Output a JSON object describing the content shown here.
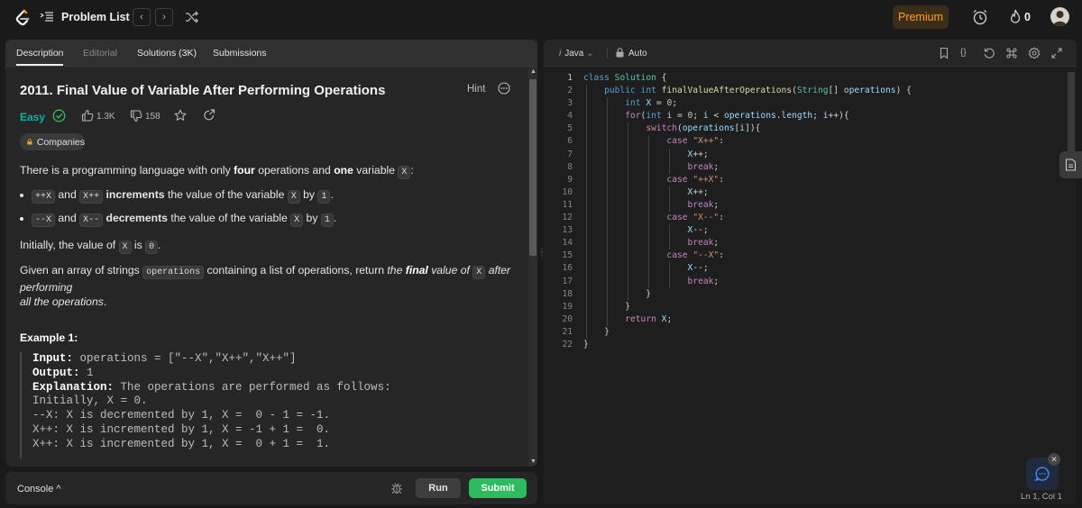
{
  "topbar": {
    "problem_list_label": "Problem List",
    "prev_label": "‹",
    "next_label": "›",
    "premium_label": "Premium",
    "streak_count": "0"
  },
  "tabs": [
    {
      "label": "Description",
      "active": true
    },
    {
      "label": "Editorial",
      "active": false
    },
    {
      "label": "Solutions (3K)",
      "active": false
    },
    {
      "label": "Submissions",
      "active": false
    }
  ],
  "problem": {
    "title": "2011. Final Value of Variable After Performing Operations",
    "hint_label": "Hint",
    "difficulty": "Easy",
    "likes": "1.3K",
    "dislikes": "158",
    "companies_label": "Companies",
    "intro_1": "There is a programming language with only ",
    "intro_bold_1": "four",
    "intro_2": " operations and ",
    "intro_bold_2": "one",
    "intro_3": " variable ",
    "var_x": "X",
    "intro_4": ":",
    "b1_code1": "++X",
    "b1_and": " and ",
    "b1_code2": "X++",
    "b1_bold": "increments",
    "b1_rest": " the value of the variable ",
    "b1_by": " by ",
    "b1_one": "1",
    "b1_end": ".",
    "b2_code1": "--X",
    "b2_code2": "X--",
    "b2_bold": "decrements",
    "init_1": "Initially, the value of ",
    "init_2": " is ",
    "init_zero": "0",
    "init_end": ".",
    "given_1": "Given an array of strings ",
    "given_code": "operations",
    "given_2": " containing a list of operations, return ",
    "given_it1": "the ",
    "given_bold": "final",
    "given_it2": " value of ",
    "given_it3": " after performing",
    "given_it4": "all the operations",
    "given_end": ".",
    "example_heading": "Example 1:",
    "example_input_label": "Input:",
    "example_input": " operations = [\"--X\",\"X++\",\"X++\"]",
    "example_output_label": "Output:",
    "example_output": " 1",
    "example_expl_label": "Explanation:",
    "example_expl": " The operations are performed as follows:",
    "example_lines": [
      "Initially, X = 0.",
      "--X: X is decremented by 1, X =  0 - 1 = -1.",
      "X++: X is incremented by 1, X = -1 + 1 =  0.",
      "X++: X is incremented by 1, X =  0 + 1 =  1."
    ]
  },
  "console": {
    "label": "Console ^",
    "run_label": "Run",
    "submit_label": "Submit"
  },
  "editor": {
    "language": "Java",
    "language_prefix": "i",
    "mode": "Auto",
    "braces_label": "{}",
    "status": "Ln 1, Col 1",
    "line_numbers": [
      "1",
      "2",
      "3",
      "4",
      "5",
      "6",
      "7",
      "8",
      "9",
      "10",
      "11",
      "12",
      "13",
      "14",
      "15",
      "16",
      "17",
      "18",
      "19",
      "20",
      "21",
      "22"
    ]
  },
  "colors": {
    "accent": "#ffa116",
    "easy": "#00b8a3",
    "submit": "#2cbb5d"
  }
}
